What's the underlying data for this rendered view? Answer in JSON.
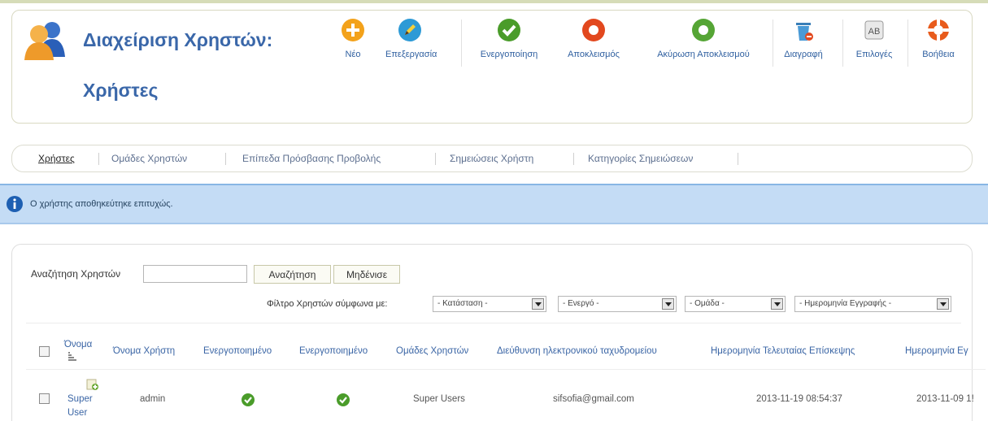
{
  "header": {
    "title": "Διαχείριση Χρηστών:",
    "subtitle": "Χρήστες"
  },
  "toolbar": {
    "new_label": "Νέο",
    "edit_label": "Επεξεργασία",
    "activate_label": "Ενεργοποίηση",
    "block_label": "Αποκλεισμός",
    "unblock_label": "Ακύρωση Αποκλεισμού",
    "delete_label": "Διαγραφή",
    "options_label": "Επιλογές",
    "help_label": "Βοήθεια"
  },
  "subnav": {
    "users": "Χρήστες",
    "groups": "Ομάδες Χρηστών",
    "access_levels": "Επίπεδα Πρόσβασης Προβολής",
    "notes": "Σημειώσεις Χρήστη",
    "note_categories": "Κατηγορίες Σημειώσεων"
  },
  "message": {
    "text": "Ο χρήστης αποθηκεύτηκε επιτυχώς."
  },
  "search": {
    "label": "Αναζήτηση Χρηστών",
    "value": "",
    "search_button": "Αναζήτηση",
    "reset_button": "Μηδένισε"
  },
  "filters": {
    "label": "Φίλτρο Χρηστών σύμφωνα με:",
    "state": "- Κατάσταση -",
    "active": "- Ενεργό -",
    "group": "- Ομάδα -",
    "registration_date": "- Ημερομηνία Εγγραφής -"
  },
  "table": {
    "headers": {
      "name": "Όνομα",
      "username": "Όνομα Χρήστη",
      "enabled": "Ενεργοποιημένο",
      "activated": "Ενεργοποιημένο",
      "groups": "Ομάδες Χρηστών",
      "email": "Διεύθυνση ηλεκτρονικού ταχυδρομείου",
      "last_visit": "Ημερομηνία Τελευταίας Επίσκεψης",
      "registration": "Ημερομηνία Εγ"
    },
    "rows": [
      {
        "name_line1": "Super",
        "name_line2": "User",
        "username": "admin",
        "group": "Super Users",
        "email": "sifsofia@gmail.com",
        "last_visit": "2013-11-19 08:54:37",
        "registered": "2013-11-09 1!"
      }
    ]
  },
  "colors": {
    "accent": "#3a67a9",
    "message_bg": "#c4dcf5",
    "ok_green": "#5a9e1a",
    "new_orange": "#f3a21b",
    "block_red": "#e2481e"
  }
}
